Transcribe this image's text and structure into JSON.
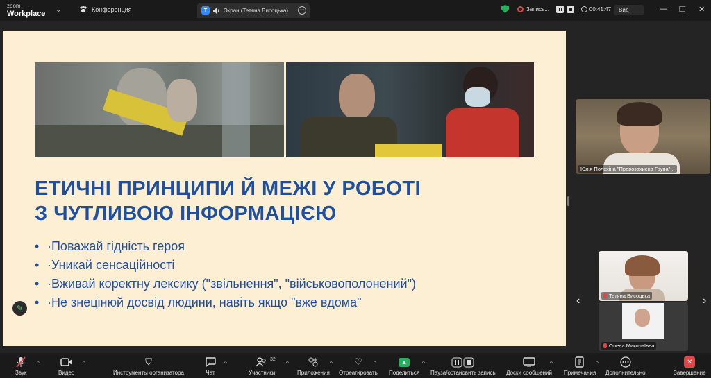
{
  "app": {
    "logo_top": "zoom",
    "logo_bottom": "Workplace"
  },
  "meeting": {
    "label": "Конференция"
  },
  "tab": {
    "badge": "T",
    "label": "Экран (Тетяна Висоцька)"
  },
  "recording": {
    "label": "Запись...",
    "time": "00:41:47"
  },
  "view": {
    "label": "Вид"
  },
  "slide": {
    "title_line1": "ЕТИЧНІ ПРИНЦИПИ Й МЕЖІ У РОБОТІ",
    "title_line2": "З ЧУТЛИВОЮ ІНФОРМАЦІЄЮ",
    "bullets": [
      "·Поважай гідність героя",
      "·Уникай сенсаційності",
      "·Вживай коректну лексику (\"звільнення\", \"військовополонений\")",
      "·Не знецінюй досвід людини, навіть якщо \"вже вдома\""
    ]
  },
  "participants": {
    "main": "Юлія Полєхіна \"Правозахисна Група\"...",
    "tile2": "Тетяна Висоцька",
    "tile3": "Олена Миколаївна",
    "count": "32"
  },
  "toolbar": {
    "audio": "Звук",
    "video": "Видео",
    "host_tools": "Инструменты организатора",
    "chat": "Чат",
    "participants": "Участники",
    "apps": "Приложения",
    "react": "Отреагировать",
    "share": "Поделиться",
    "pause_rec": "Пауза/остановить запись",
    "whiteboards": "Доски сообщений",
    "notes": "Примечания",
    "more": "Дополнительно",
    "end": "Завершение"
  },
  "colors": {
    "accent": "#2d8cff",
    "title_blue": "#1f4fa0",
    "slide_bg": "#fdefd3",
    "share_green": "#21b35c",
    "end_red": "#e34545"
  }
}
